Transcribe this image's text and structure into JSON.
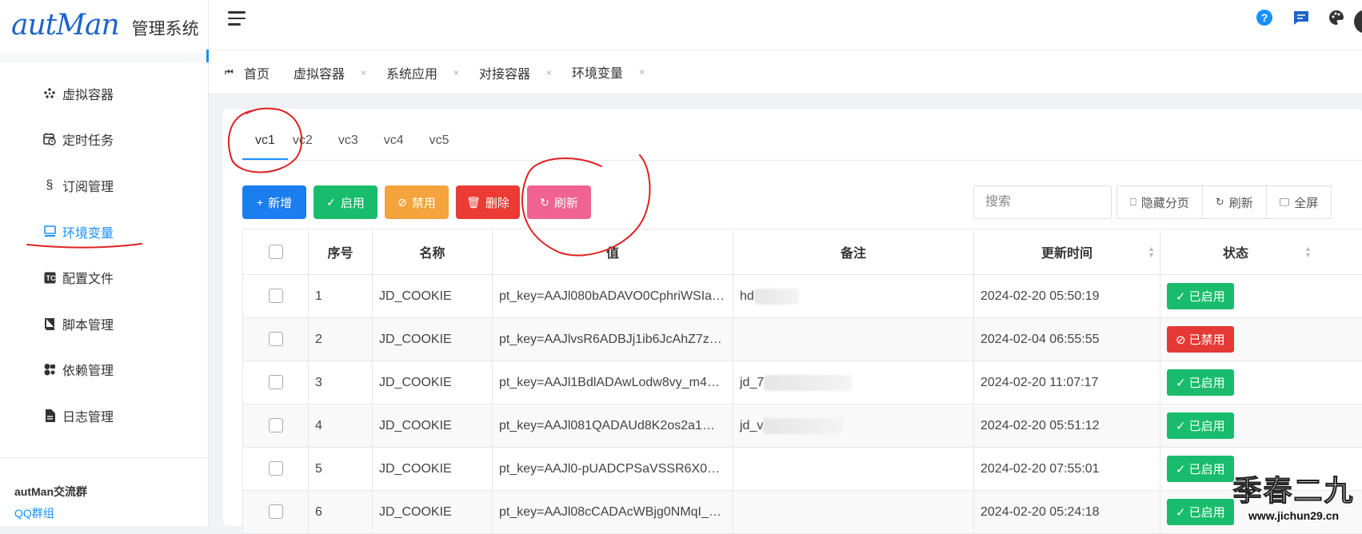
{
  "app": {
    "logo": "autMan",
    "title": "管理系统"
  },
  "colors": {
    "accent": "#1890ff",
    "annotation": "#e02020",
    "enabled": "#18bc6c",
    "disabled": "#e53935"
  },
  "sidebar": {
    "items": [
      {
        "label": "虚拟容器",
        "icon": "dots-grid-icon"
      },
      {
        "label": "定时任务",
        "icon": "calendar-clock-icon"
      },
      {
        "label": "订阅管理",
        "icon": "section-icon"
      },
      {
        "label": "环境变量",
        "icon": "monitor-icon",
        "active": true
      },
      {
        "label": "配置文件",
        "icon": "tc-icon"
      },
      {
        "label": "脚本管理",
        "icon": "book-icon"
      },
      {
        "label": "依赖管理",
        "icon": "shapes-icon"
      },
      {
        "label": "日志管理",
        "icon": "file-icon"
      }
    ],
    "group_title": "autMan交流群",
    "group_link": "QQ群组"
  },
  "page_tabs": [
    {
      "label": "首页"
    },
    {
      "label": "虚拟容器",
      "close": "×"
    },
    {
      "label": "系统应用",
      "close": "×"
    },
    {
      "label": "对接容器",
      "close": "×"
    },
    {
      "label": "环境变量",
      "close": "×",
      "active": true
    }
  ],
  "vc_tabs": [
    "vc1",
    "vc2",
    "vc3",
    "vc4",
    "vc5"
  ],
  "toolbar": {
    "add": "新增",
    "enable": "启用",
    "disable": "禁用",
    "delete": "删除",
    "refresh": "刷新",
    "search_placeholder": "搜索",
    "hide_paging": "隐藏分页",
    "refresh2": "刷新",
    "fullscreen": "全屏"
  },
  "table": {
    "headers": [
      "序号",
      "名称",
      "值",
      "备注",
      "更新时间",
      "状态"
    ],
    "rows": [
      {
        "no": "1",
        "name": "JD_COOKIE",
        "value": "pt_key=AAJl080bADAVO0CphriWSIaYc...",
        "note": "hd",
        "time": "2024-02-20 05:50:19",
        "status": "已启用",
        "enabled": true
      },
      {
        "no": "2",
        "name": "JD_COOKIE",
        "value": "pt_key=AAJlvsR6ADBJj1ib6JcAhZ7zU-k...",
        "note": "",
        "time": "2024-02-04 06:55:55",
        "status": "已禁用",
        "enabled": false
      },
      {
        "no": "3",
        "name": "JD_COOKIE",
        "value": "pt_key=AAJl1BdlADAwLodw8vy_m43P...",
        "note": "jd_7",
        "time": "2024-02-20 11:07:17",
        "status": "已启用",
        "enabled": true
      },
      {
        "no": "4",
        "name": "JD_COOKIE",
        "value": "pt_key=AAJl081QADAUd8K2os2a1WD...",
        "note": "jd_v",
        "time": "2024-02-20 05:51:12",
        "status": "已启用",
        "enabled": true
      },
      {
        "no": "5",
        "name": "JD_COOKIE",
        "value": "pt_key=AAJl0-pUADCPSaVSSR6X0CAb...",
        "note": "",
        "time": "2024-02-20 07:55:01",
        "status": "已启用",
        "enabled": true
      },
      {
        "no": "6",
        "name": "JD_COOKIE",
        "value": "pt_key=AAJl08cCADAcWBjg0NMqI_U5...",
        "note": "",
        "time": "2024-02-20 05:24:18",
        "status": "已启用",
        "enabled": true
      }
    ]
  },
  "watermark": {
    "big": "季春二九",
    "small": "www.jichun29.cn"
  }
}
